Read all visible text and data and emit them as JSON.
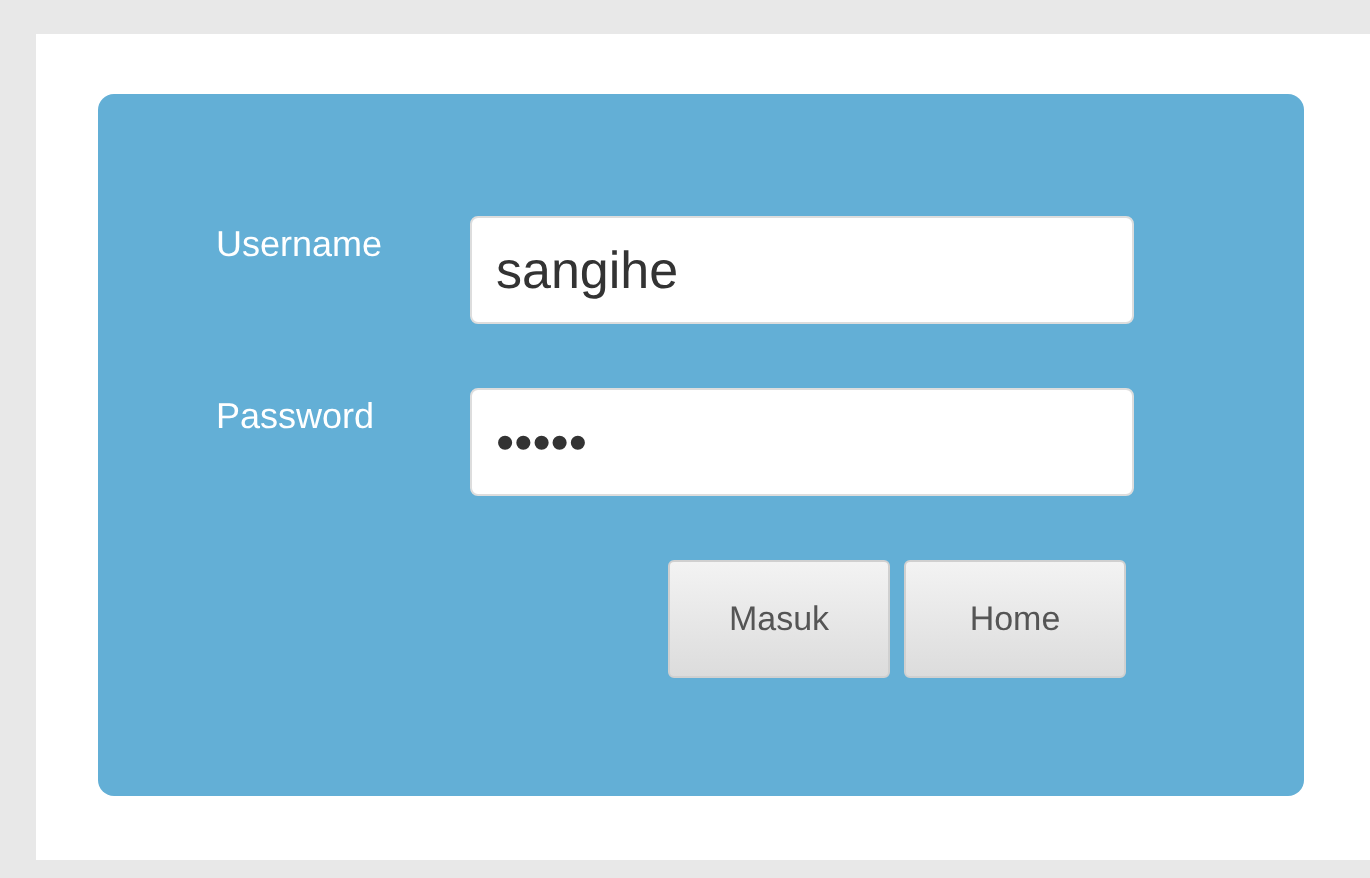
{
  "form": {
    "fields": [
      {
        "label": "Username",
        "value": "sangihe"
      },
      {
        "label": "Password",
        "value": "•••••"
      }
    ],
    "buttons": [
      "Masuk",
      "Home"
    ]
  }
}
